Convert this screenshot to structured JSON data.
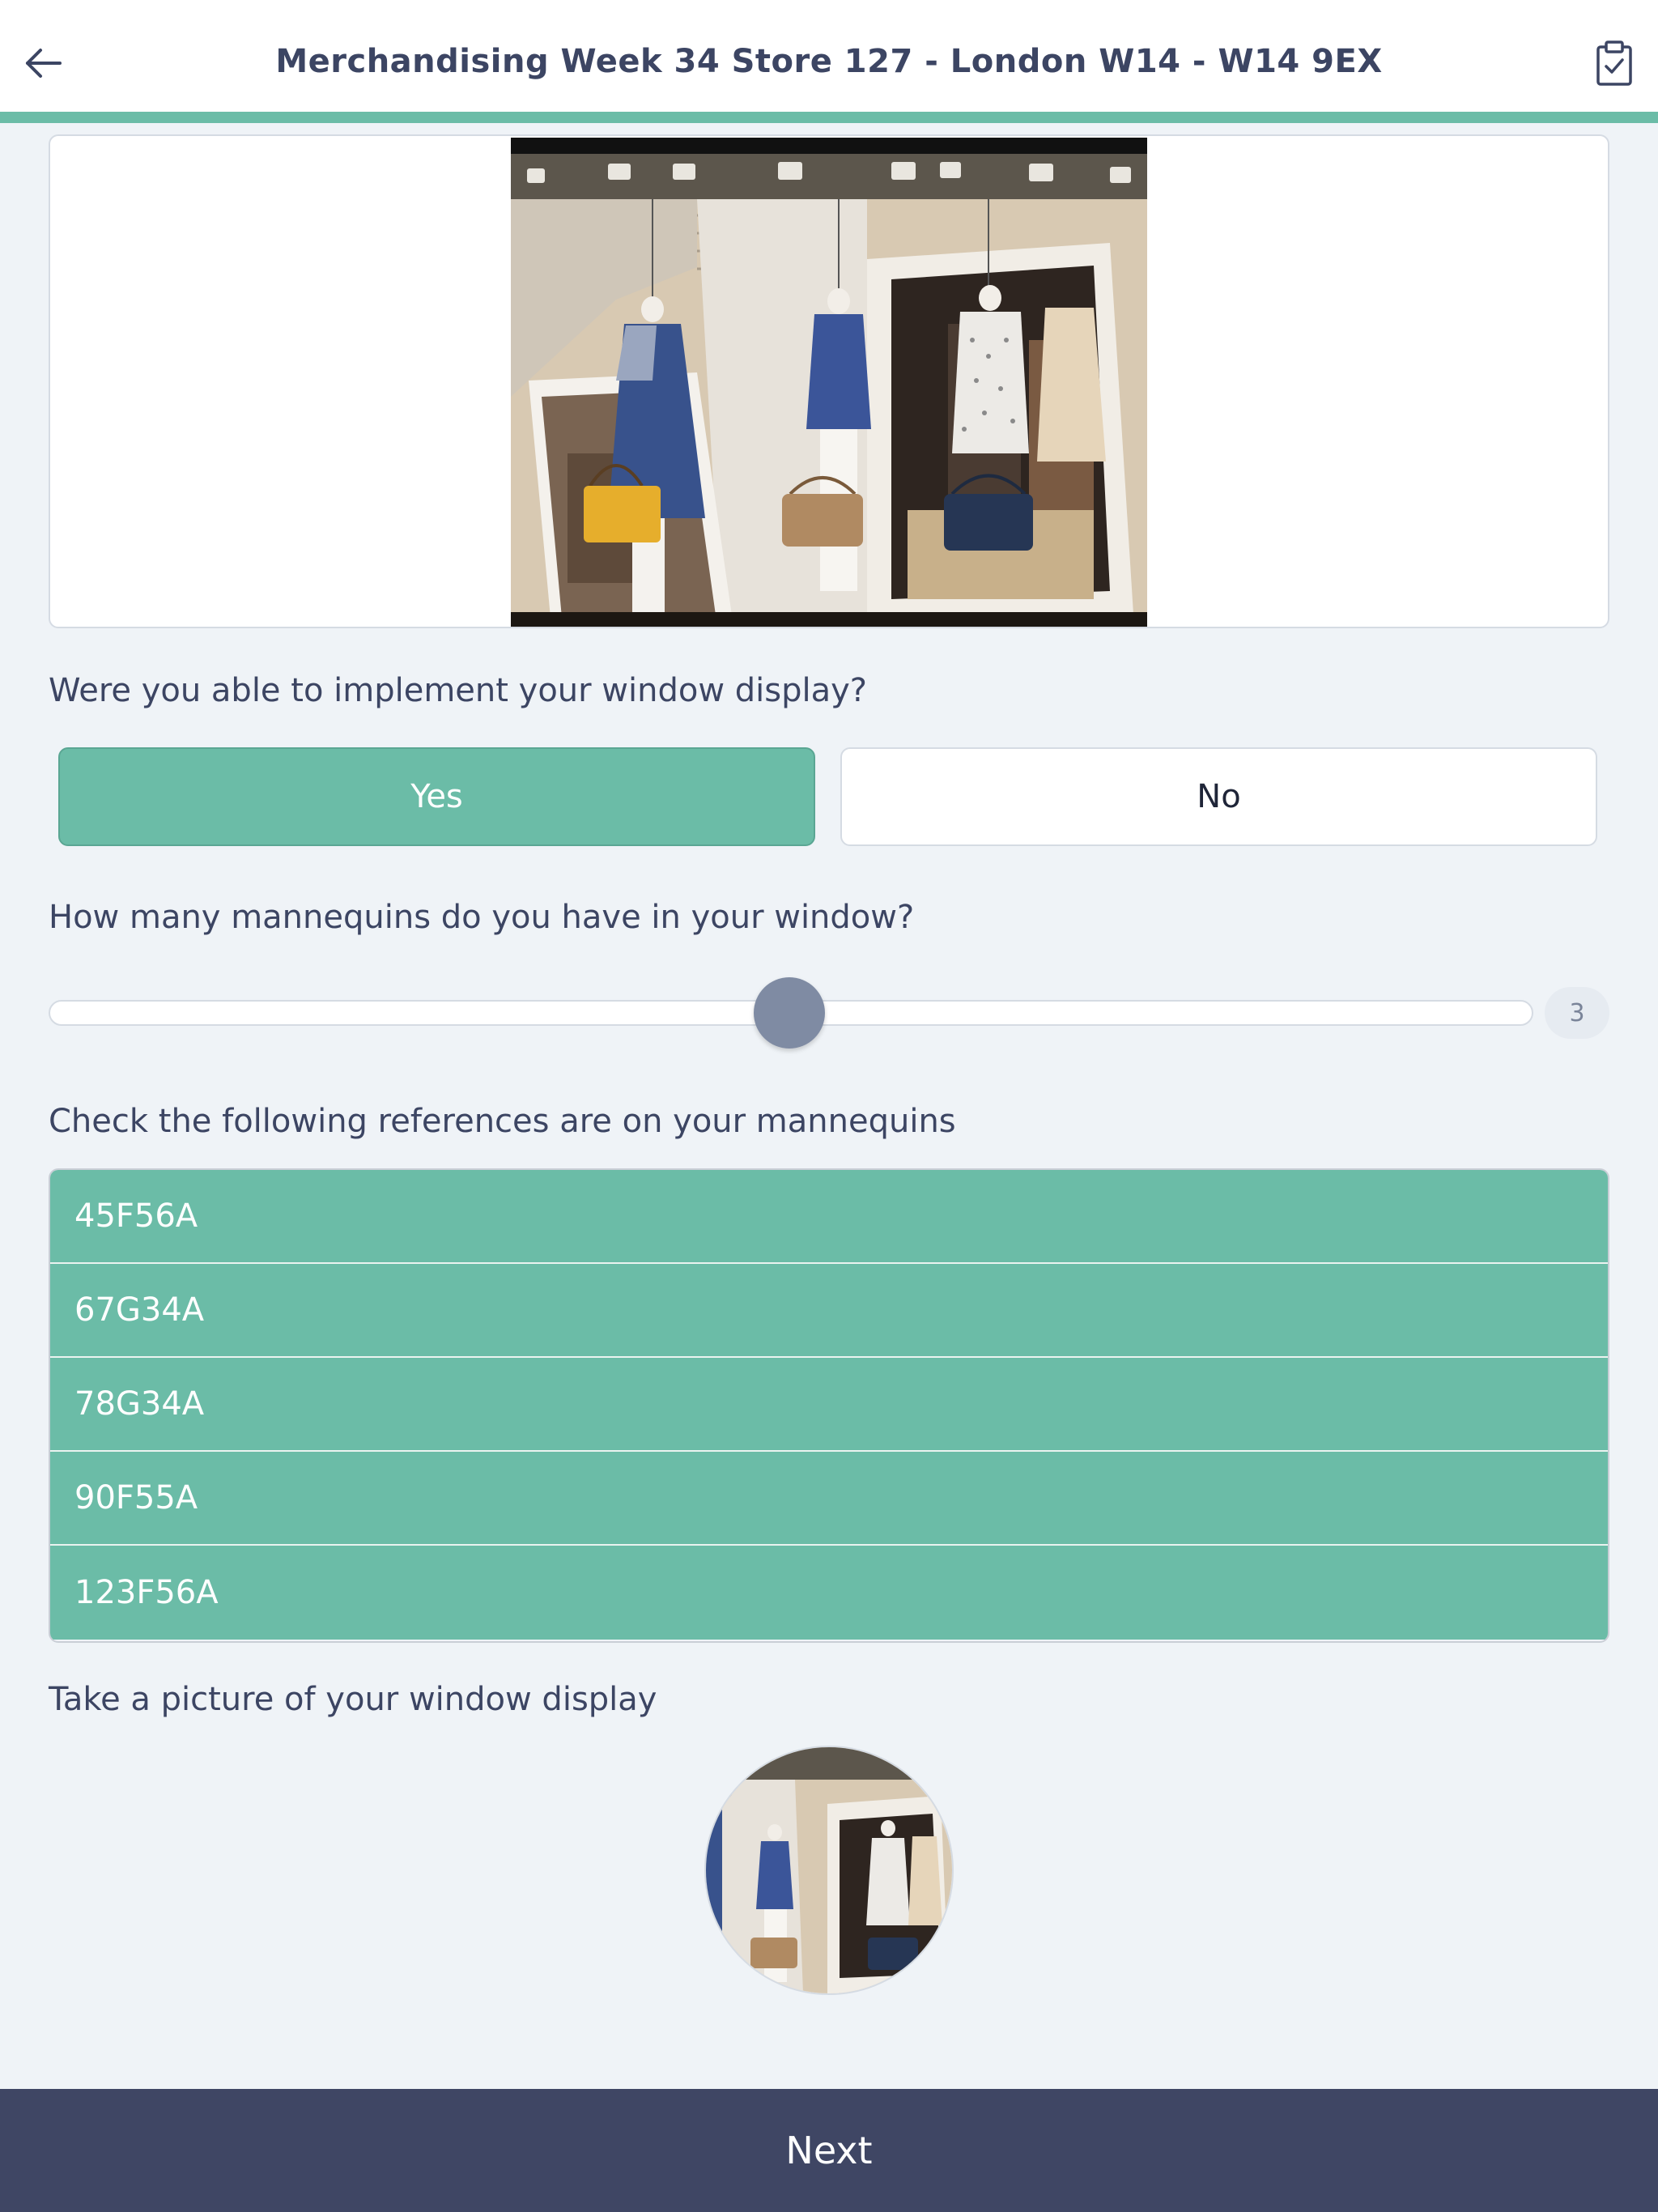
{
  "header": {
    "title": "Merchandising Week 34 Store 127 - London W14 - W14 9EX",
    "back_icon": "arrow-left-icon",
    "checklist_icon": "clipboard-check-icon"
  },
  "questions": {
    "window_display": "Were you able to implement your window display?",
    "mannequins": "How many mannequins do you have in your window?",
    "references": "Check the following references are on your mannequins",
    "picture": "Take a picture of your window display"
  },
  "buttons": {
    "yes": "Yes",
    "no": "No",
    "selected": "Yes"
  },
  "slider": {
    "value": "3",
    "position_fraction": 0.5
  },
  "references": [
    "45F56A",
    "67G34A",
    "78G34A",
    "90F55A",
    "123F56A"
  ],
  "footer": {
    "next_label": "Next"
  },
  "colors": {
    "accent": "#6bbca7",
    "navy": "#3f4664",
    "background": "#eff3f7",
    "text": "#3c4563"
  }
}
